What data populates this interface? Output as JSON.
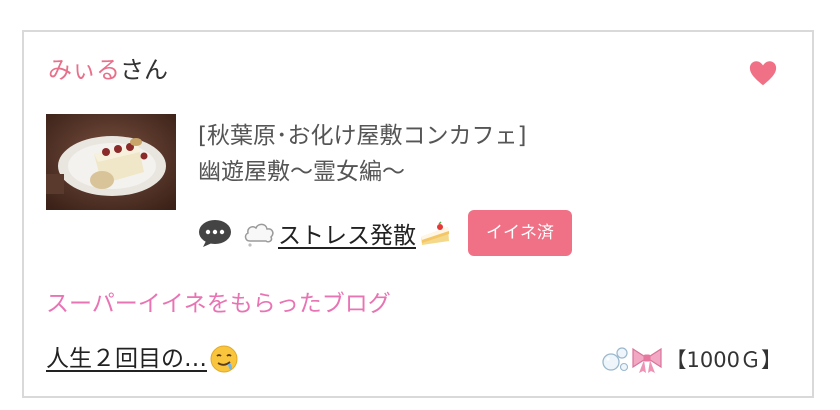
{
  "user": {
    "name": "みぃる",
    "suffix": "さん"
  },
  "entry": {
    "title_line1": "[秋葉原･お化け屋敷コンカフェ]",
    "title_line2": "幽遊屋敷〜霊女編〜",
    "thumbnail_icon": "cake-photo"
  },
  "comment": {
    "icon": "speech-bubble-icon",
    "text": "ストレス発散",
    "leading_emoji": "cloud-icon",
    "trailing_emoji": "cake-icon"
  },
  "iine_badge": {
    "label": "イイネ済"
  },
  "super_iine": {
    "label": "スーパーイイネをもらったブログ",
    "blog_title": "人生２回目の…",
    "blog_emoji": "drooling-face-icon",
    "points": "【1000Ｇ】"
  },
  "colors": {
    "accent_pink": "#f07086",
    "username_pink": "#e8708a",
    "super_label_pink": "#e874b4",
    "border": "#d9d9d9"
  }
}
